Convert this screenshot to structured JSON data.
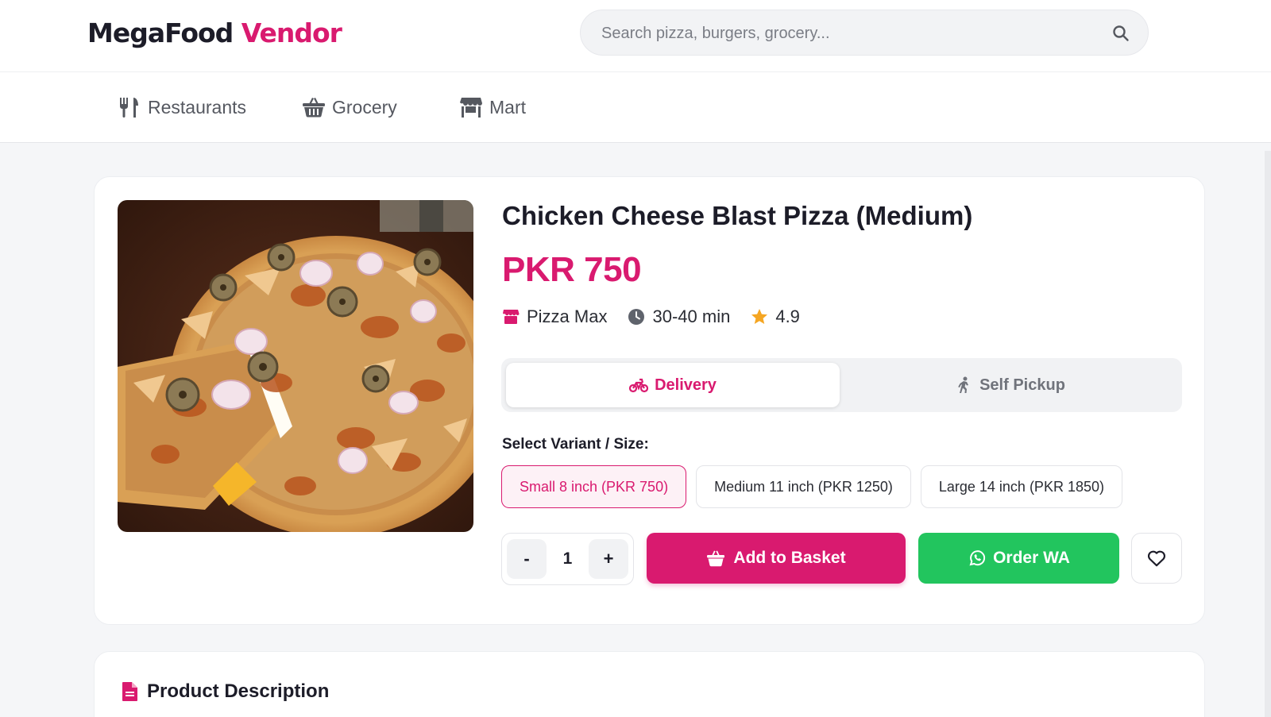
{
  "header": {
    "brand_part1": "MegaFood",
    "brand_part2": "Vendor",
    "search_placeholder": "Search pizza, burgers, grocery...",
    "search_icon": "search-icon"
  },
  "nav": {
    "items": [
      {
        "label": "Restaurants",
        "icon": "utensils-icon"
      },
      {
        "label": "Grocery",
        "icon": "basket-icon"
      },
      {
        "label": "Mart",
        "icon": "store-icon"
      }
    ]
  },
  "product": {
    "title": "Chicken Cheese Blast Pizza (Medium)",
    "price": "PKR 750",
    "vendor": "Pizza Max",
    "time": "30-40 min",
    "rating": "4.9",
    "image_icon": "pizza-photo"
  },
  "fulfillment": {
    "delivery_label": "Delivery",
    "pickup_label": "Self Pickup",
    "selected": "Delivery"
  },
  "variants": {
    "label": "Select Variant / Size:",
    "options": [
      "Small 8 inch (PKR 750)",
      "Medium 11 inch (PKR 1250)",
      "Large 14 inch (PKR 1850)"
    ],
    "selected_index": 0
  },
  "actions": {
    "minus": "-",
    "quantity": "1",
    "plus": "+",
    "add_to_basket": "Add to Basket",
    "order_wa": "Order WA"
  },
  "description": {
    "heading": "Product Description"
  },
  "colors": {
    "brand": "#d91a6f",
    "whatsapp": "#22c55e",
    "rating_star": "#f5a623"
  }
}
